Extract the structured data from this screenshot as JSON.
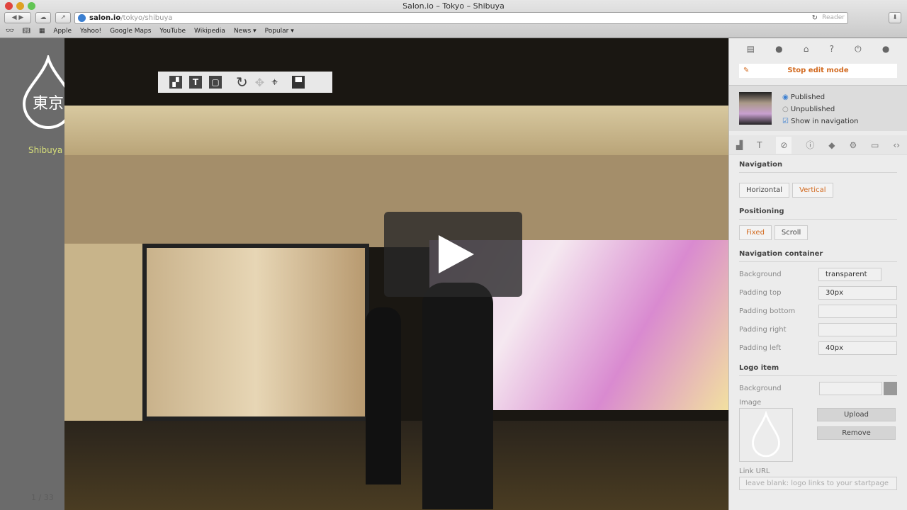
{
  "browser": {
    "title": "Salon.io – Tokyo – Shibuya",
    "url_host": "salon.io",
    "url_path": "/tokyo/shibuya",
    "reader": "Reader",
    "bookmarks": [
      "Apple",
      "Yahoo!",
      "Google Maps",
      "YouTube",
      "Wikipedia",
      "News ▾",
      "Popular ▾"
    ]
  },
  "site": {
    "logo_text": "東京",
    "nav_item": "Shibuya",
    "pager": "1 / 33",
    "accent": "#d8e07a"
  },
  "panel": {
    "stop_edit": "Stop edit mode",
    "published": "Published",
    "unpublished": "Unpublished",
    "show_in_nav": "Show in navigation",
    "navigation": "Navigation",
    "horizontal": "Horizontal",
    "vertical": "Vertical",
    "positioning": "Positioning",
    "fixed": "Fixed",
    "scroll": "Scroll",
    "nav_container": "Navigation container",
    "fields": [
      {
        "label": "Background",
        "value": "transparent"
      },
      {
        "label": "Padding top",
        "value": "30px"
      },
      {
        "label": "Padding bottom",
        "value": ""
      },
      {
        "label": "Padding right",
        "value": ""
      },
      {
        "label": "Padding left",
        "value": "40px"
      }
    ],
    "logo_item": "Logo item",
    "logo_bg": "Background",
    "image": "Image",
    "upload": "Upload",
    "remove": "Remove",
    "link_url": "Link URL",
    "link_placeholder": "leave blank: logo links to your startpage",
    "accent": "#d2691e"
  }
}
